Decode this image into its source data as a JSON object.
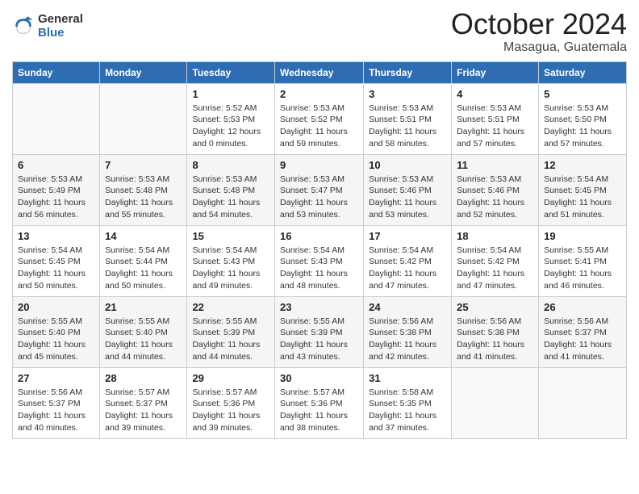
{
  "logo": {
    "general": "General",
    "blue": "Blue"
  },
  "title": "October 2024",
  "location": "Masagua, Guatemala",
  "days_of_week": [
    "Sunday",
    "Monday",
    "Tuesday",
    "Wednesday",
    "Thursday",
    "Friday",
    "Saturday"
  ],
  "weeks": [
    [
      null,
      null,
      {
        "day": "1",
        "sunrise": "Sunrise: 5:52 AM",
        "sunset": "Sunset: 5:53 PM",
        "daylight": "Daylight: 12 hours and 0 minutes."
      },
      {
        "day": "2",
        "sunrise": "Sunrise: 5:53 AM",
        "sunset": "Sunset: 5:52 PM",
        "daylight": "Daylight: 11 hours and 59 minutes."
      },
      {
        "day": "3",
        "sunrise": "Sunrise: 5:53 AM",
        "sunset": "Sunset: 5:51 PM",
        "daylight": "Daylight: 11 hours and 58 minutes."
      },
      {
        "day": "4",
        "sunrise": "Sunrise: 5:53 AM",
        "sunset": "Sunset: 5:51 PM",
        "daylight": "Daylight: 11 hours and 57 minutes."
      },
      {
        "day": "5",
        "sunrise": "Sunrise: 5:53 AM",
        "sunset": "Sunset: 5:50 PM",
        "daylight": "Daylight: 11 hours and 57 minutes."
      }
    ],
    [
      {
        "day": "6",
        "sunrise": "Sunrise: 5:53 AM",
        "sunset": "Sunset: 5:49 PM",
        "daylight": "Daylight: 11 hours and 56 minutes."
      },
      {
        "day": "7",
        "sunrise": "Sunrise: 5:53 AM",
        "sunset": "Sunset: 5:48 PM",
        "daylight": "Daylight: 11 hours and 55 minutes."
      },
      {
        "day": "8",
        "sunrise": "Sunrise: 5:53 AM",
        "sunset": "Sunset: 5:48 PM",
        "daylight": "Daylight: 11 hours and 54 minutes."
      },
      {
        "day": "9",
        "sunrise": "Sunrise: 5:53 AM",
        "sunset": "Sunset: 5:47 PM",
        "daylight": "Daylight: 11 hours and 53 minutes."
      },
      {
        "day": "10",
        "sunrise": "Sunrise: 5:53 AM",
        "sunset": "Sunset: 5:46 PM",
        "daylight": "Daylight: 11 hours and 53 minutes."
      },
      {
        "day": "11",
        "sunrise": "Sunrise: 5:53 AM",
        "sunset": "Sunset: 5:46 PM",
        "daylight": "Daylight: 11 hours and 52 minutes."
      },
      {
        "day": "12",
        "sunrise": "Sunrise: 5:54 AM",
        "sunset": "Sunset: 5:45 PM",
        "daylight": "Daylight: 11 hours and 51 minutes."
      }
    ],
    [
      {
        "day": "13",
        "sunrise": "Sunrise: 5:54 AM",
        "sunset": "Sunset: 5:45 PM",
        "daylight": "Daylight: 11 hours and 50 minutes."
      },
      {
        "day": "14",
        "sunrise": "Sunrise: 5:54 AM",
        "sunset": "Sunset: 5:44 PM",
        "daylight": "Daylight: 11 hours and 50 minutes."
      },
      {
        "day": "15",
        "sunrise": "Sunrise: 5:54 AM",
        "sunset": "Sunset: 5:43 PM",
        "daylight": "Daylight: 11 hours and 49 minutes."
      },
      {
        "day": "16",
        "sunrise": "Sunrise: 5:54 AM",
        "sunset": "Sunset: 5:43 PM",
        "daylight": "Daylight: 11 hours and 48 minutes."
      },
      {
        "day": "17",
        "sunrise": "Sunrise: 5:54 AM",
        "sunset": "Sunset: 5:42 PM",
        "daylight": "Daylight: 11 hours and 47 minutes."
      },
      {
        "day": "18",
        "sunrise": "Sunrise: 5:54 AM",
        "sunset": "Sunset: 5:42 PM",
        "daylight": "Daylight: 11 hours and 47 minutes."
      },
      {
        "day": "19",
        "sunrise": "Sunrise: 5:55 AM",
        "sunset": "Sunset: 5:41 PM",
        "daylight": "Daylight: 11 hours and 46 minutes."
      }
    ],
    [
      {
        "day": "20",
        "sunrise": "Sunrise: 5:55 AM",
        "sunset": "Sunset: 5:40 PM",
        "daylight": "Daylight: 11 hours and 45 minutes."
      },
      {
        "day": "21",
        "sunrise": "Sunrise: 5:55 AM",
        "sunset": "Sunset: 5:40 PM",
        "daylight": "Daylight: 11 hours and 44 minutes."
      },
      {
        "day": "22",
        "sunrise": "Sunrise: 5:55 AM",
        "sunset": "Sunset: 5:39 PM",
        "daylight": "Daylight: 11 hours and 44 minutes."
      },
      {
        "day": "23",
        "sunrise": "Sunrise: 5:55 AM",
        "sunset": "Sunset: 5:39 PM",
        "daylight": "Daylight: 11 hours and 43 minutes."
      },
      {
        "day": "24",
        "sunrise": "Sunrise: 5:56 AM",
        "sunset": "Sunset: 5:38 PM",
        "daylight": "Daylight: 11 hours and 42 minutes."
      },
      {
        "day": "25",
        "sunrise": "Sunrise: 5:56 AM",
        "sunset": "Sunset: 5:38 PM",
        "daylight": "Daylight: 11 hours and 41 minutes."
      },
      {
        "day": "26",
        "sunrise": "Sunrise: 5:56 AM",
        "sunset": "Sunset: 5:37 PM",
        "daylight": "Daylight: 11 hours and 41 minutes."
      }
    ],
    [
      {
        "day": "27",
        "sunrise": "Sunrise: 5:56 AM",
        "sunset": "Sunset: 5:37 PM",
        "daylight": "Daylight: 11 hours and 40 minutes."
      },
      {
        "day": "28",
        "sunrise": "Sunrise: 5:57 AM",
        "sunset": "Sunset: 5:37 PM",
        "daylight": "Daylight: 11 hours and 39 minutes."
      },
      {
        "day": "29",
        "sunrise": "Sunrise: 5:57 AM",
        "sunset": "Sunset: 5:36 PM",
        "daylight": "Daylight: 11 hours and 39 minutes."
      },
      {
        "day": "30",
        "sunrise": "Sunrise: 5:57 AM",
        "sunset": "Sunset: 5:36 PM",
        "daylight": "Daylight: 11 hours and 38 minutes."
      },
      {
        "day": "31",
        "sunrise": "Sunrise: 5:58 AM",
        "sunset": "Sunset: 5:35 PM",
        "daylight": "Daylight: 11 hours and 37 minutes."
      },
      null,
      null
    ]
  ]
}
